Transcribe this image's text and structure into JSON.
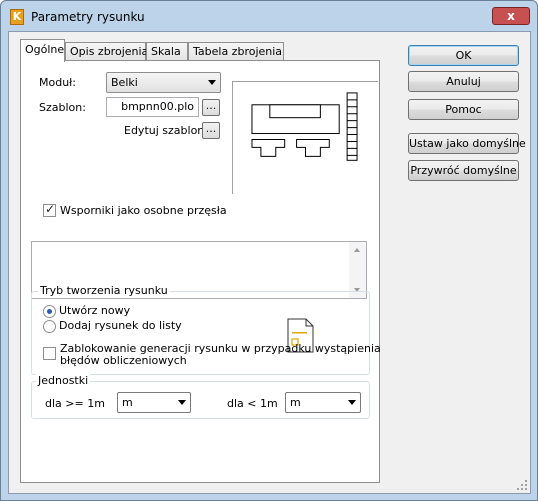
{
  "window": {
    "title": "Parametry rysunku",
    "app_icon_letter": "K",
    "close_symbol": "x"
  },
  "tabs": [
    {
      "label": "Ogólne",
      "active": true
    },
    {
      "label": "Opis zbrojenia",
      "active": false
    },
    {
      "label": "Skala",
      "active": false
    },
    {
      "label": "Tabela zbrojenia",
      "active": false
    }
  ],
  "general": {
    "module_label": "Moduł:",
    "module_value": "Belki",
    "template_label": "Szablon:",
    "template_value": "bmpnn00.plo",
    "browse_label": "...",
    "edit_template_label": "Edytuj szablon:",
    "edit_button_label": "...",
    "supports_checkbox_label": "Wsporniki jako osobne przęsła",
    "supports_checked": true
  },
  "mode_group": {
    "title": "Tryb tworzenia rysunku",
    "options": [
      {
        "label": "Utwórz nowy",
        "selected": true
      },
      {
        "label": "Dodaj rysunek do listy",
        "selected": false
      }
    ],
    "block_checkbox_line1": "Zablokowanie generacji rysunku w przypadku wystąpienia",
    "block_checkbox_line2": "błędów obliczeniowych",
    "block_checked": false
  },
  "units_group": {
    "title": "Jednostki",
    "ge_label": "dla >= 1m",
    "ge_value": "m",
    "lt_label": "dla < 1m",
    "lt_value": "m"
  },
  "buttons": {
    "ok": "OK",
    "cancel": "Anuluj",
    "help": "Pomoc",
    "set_default": "Ustaw jako domyślne",
    "restore_default": "Przywróć domyślne"
  },
  "icons": {
    "dropdown": "chevron-down-icon",
    "preview": "beam-drawing-preview-icon",
    "document": "drawing-document-icon",
    "grip": "resize-grip-icon"
  },
  "colors": {
    "title_bar": "#bcd3ea",
    "close_button": "#c75050",
    "default_button_border": "#3c7fb1",
    "radio_dot": "#2a5db0",
    "doc_icon_accent": "#e0a800"
  }
}
